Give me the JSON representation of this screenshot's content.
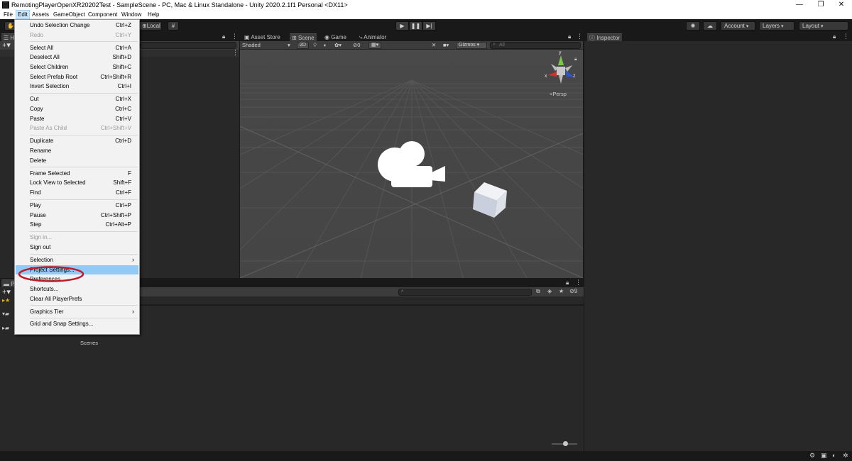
{
  "window": {
    "title": "RemotingPlayerOpenXR20202Test - SampleScene - PC, Mac & Linux Standalone - Unity 2020.2.1f1 Personal <DX11>",
    "controls": [
      "—",
      "❐",
      "✕"
    ]
  },
  "menubar": [
    "File",
    "Edit",
    "Assets",
    "GameObject",
    "Component",
    "Window",
    "Help"
  ],
  "toolbar": {
    "local": "Local",
    "account": "Account",
    "layers": "Layers",
    "layout": "Layout"
  },
  "tabs": {
    "asset_store": "Asset Store",
    "scene": "Scene",
    "game": "Game",
    "animator": "Animator",
    "inspector": "Inspector",
    "hierarchy_short": "H",
    "project_short": "P"
  },
  "scene_toolbar": {
    "shading": "Shaded",
    "mode_2d": "2D",
    "hidden_count": "0",
    "gizmos": "Gizmos",
    "search_placeholder": "All",
    "projection": "Persp"
  },
  "gizmo_axes": {
    "y": "y",
    "x": "x",
    "z": "z"
  },
  "edit_menu": [
    {
      "label": "Undo Selection Change",
      "shortcut": "Ctrl+Z"
    },
    {
      "label": "Redo",
      "shortcut": "Ctrl+Y",
      "disabled": true
    },
    {
      "label": "Select All",
      "shortcut": "Ctrl+A"
    },
    {
      "label": "Deselect All",
      "shortcut": "Shift+D"
    },
    {
      "label": "Select Children",
      "shortcut": "Shift+C"
    },
    {
      "label": "Select Prefab Root",
      "shortcut": "Ctrl+Shift+R"
    },
    {
      "label": "Invert Selection",
      "shortcut": "Ctrl+I"
    },
    {
      "label": "Cut",
      "shortcut": "Ctrl+X"
    },
    {
      "label": "Copy",
      "shortcut": "Ctrl+C"
    },
    {
      "label": "Paste",
      "shortcut": "Ctrl+V"
    },
    {
      "label": "Paste As Child",
      "shortcut": "Ctrl+Shift+V",
      "disabled": true
    },
    {
      "label": "Duplicate",
      "shortcut": "Ctrl+D"
    },
    {
      "label": "Rename",
      "shortcut": ""
    },
    {
      "label": "Delete",
      "shortcut": ""
    },
    {
      "label": "Frame Selected",
      "shortcut": "F"
    },
    {
      "label": "Lock View to Selected",
      "shortcut": "Shift+F"
    },
    {
      "label": "Find",
      "shortcut": "Ctrl+F"
    },
    {
      "label": "Play",
      "shortcut": "Ctrl+P"
    },
    {
      "label": "Pause",
      "shortcut": "Ctrl+Shift+P"
    },
    {
      "label": "Step",
      "shortcut": "Ctrl+Alt+P"
    },
    {
      "label": "Sign in...",
      "shortcut": "",
      "disabled": true
    },
    {
      "label": "Sign out",
      "shortcut": ""
    },
    {
      "label": "Selection",
      "shortcut": ">"
    },
    {
      "label": "Project Settings...",
      "shortcut": "",
      "highlighted": true
    },
    {
      "label": "Preferences...",
      "shortcut": ""
    },
    {
      "label": "Shortcuts...",
      "shortcut": ""
    },
    {
      "label": "Clear All PlayerPrefs",
      "shortcut": ""
    },
    {
      "label": "Graphics Tier",
      "shortcut": ">"
    },
    {
      "label": "Grid and Snap Settings...",
      "shortcut": ""
    }
  ],
  "project": {
    "folder_label": "Scenes",
    "hidden_count": "9"
  },
  "colors": {
    "annotation_circle": "#c01a2a",
    "menu_highlight": "#91c9f7",
    "gizmo_x": "#d23030",
    "gizmo_y": "#7ac943",
    "gizmo_z": "#2c57d4"
  }
}
